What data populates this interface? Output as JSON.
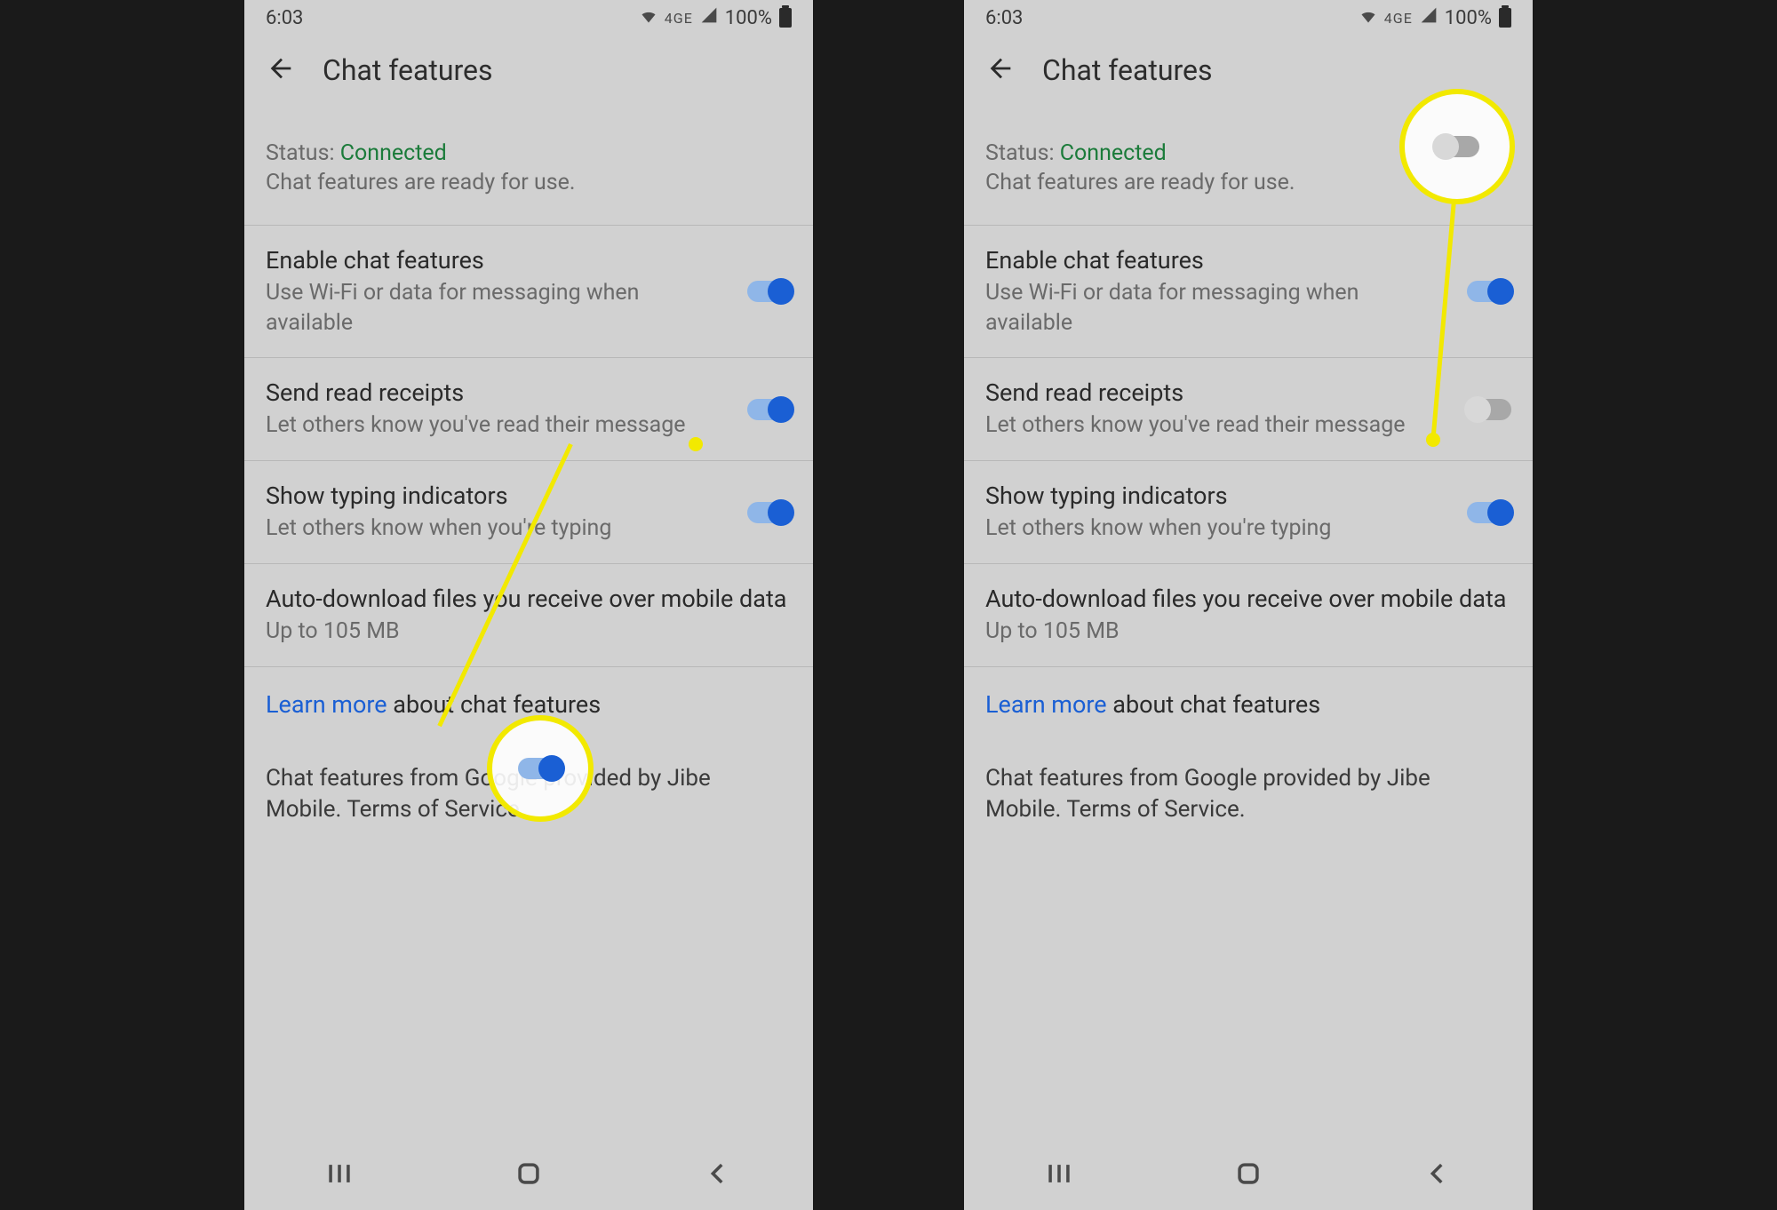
{
  "statusbar": {
    "time": "6:03",
    "network": "4GE",
    "battery": "100%"
  },
  "header": {
    "title": "Chat features"
  },
  "status": {
    "label": "Status: ",
    "value": "Connected",
    "sub": "Chat features are ready for use."
  },
  "settings": {
    "enable": {
      "title": "Enable chat features",
      "sub": "Use Wi-Fi or data for messaging when available"
    },
    "receipts": {
      "title": "Send read receipts",
      "sub": "Let others know you've read their message"
    },
    "typing": {
      "title": "Show typing indicators",
      "sub": "Let others know when you're typing"
    },
    "auto": {
      "title": "Auto-download files you receive over mobile data",
      "sub": "Up to 105 MB"
    }
  },
  "learnmore": {
    "link": "Learn more",
    "rest": " about chat features"
  },
  "provider": "Chat features from Google provided by Jibe Mobile. Terms of Service.",
  "screens": {
    "left": {
      "receipts_on": true
    },
    "right": {
      "receipts_on": false
    }
  }
}
